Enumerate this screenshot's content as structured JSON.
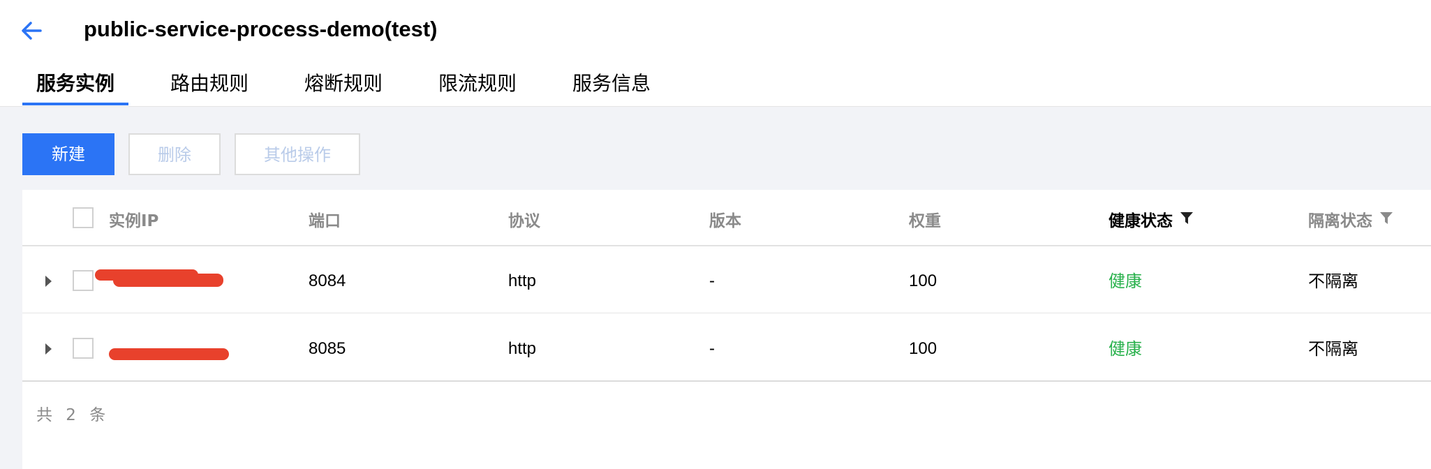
{
  "page": {
    "title": "public-service-process-demo(test)"
  },
  "tabs": [
    {
      "label": "服务实例",
      "active": true
    },
    {
      "label": "路由规则",
      "active": false
    },
    {
      "label": "熔断规则",
      "active": false
    },
    {
      "label": "限流规则",
      "active": false
    },
    {
      "label": "服务信息",
      "active": false
    }
  ],
  "toolbar": {
    "new_label": "新建",
    "delete_label": "删除",
    "more_label": "其他操作"
  },
  "table": {
    "columns": {
      "ip": "实例IP",
      "port": "端口",
      "protocol": "协议",
      "version": "版本",
      "weight": "权重",
      "health": "健康状态",
      "isolation": "隔离状态"
    },
    "rows": [
      {
        "port": "8084",
        "protocol": "http",
        "version": "-",
        "weight": "100",
        "health": "健康",
        "isolation": "不隔离"
      },
      {
        "port": "8085",
        "protocol": "http",
        "version": "-",
        "weight": "100",
        "health": "健康",
        "isolation": "不隔离"
      }
    ],
    "total_text": "共 2 条"
  },
  "colors": {
    "accent": "#2b74f5",
    "healthy": "#29b14c",
    "redaction": "#e8412c"
  },
  "icons": [
    "back-arrow-icon",
    "filter-icon",
    "expand-caret-icon"
  ]
}
